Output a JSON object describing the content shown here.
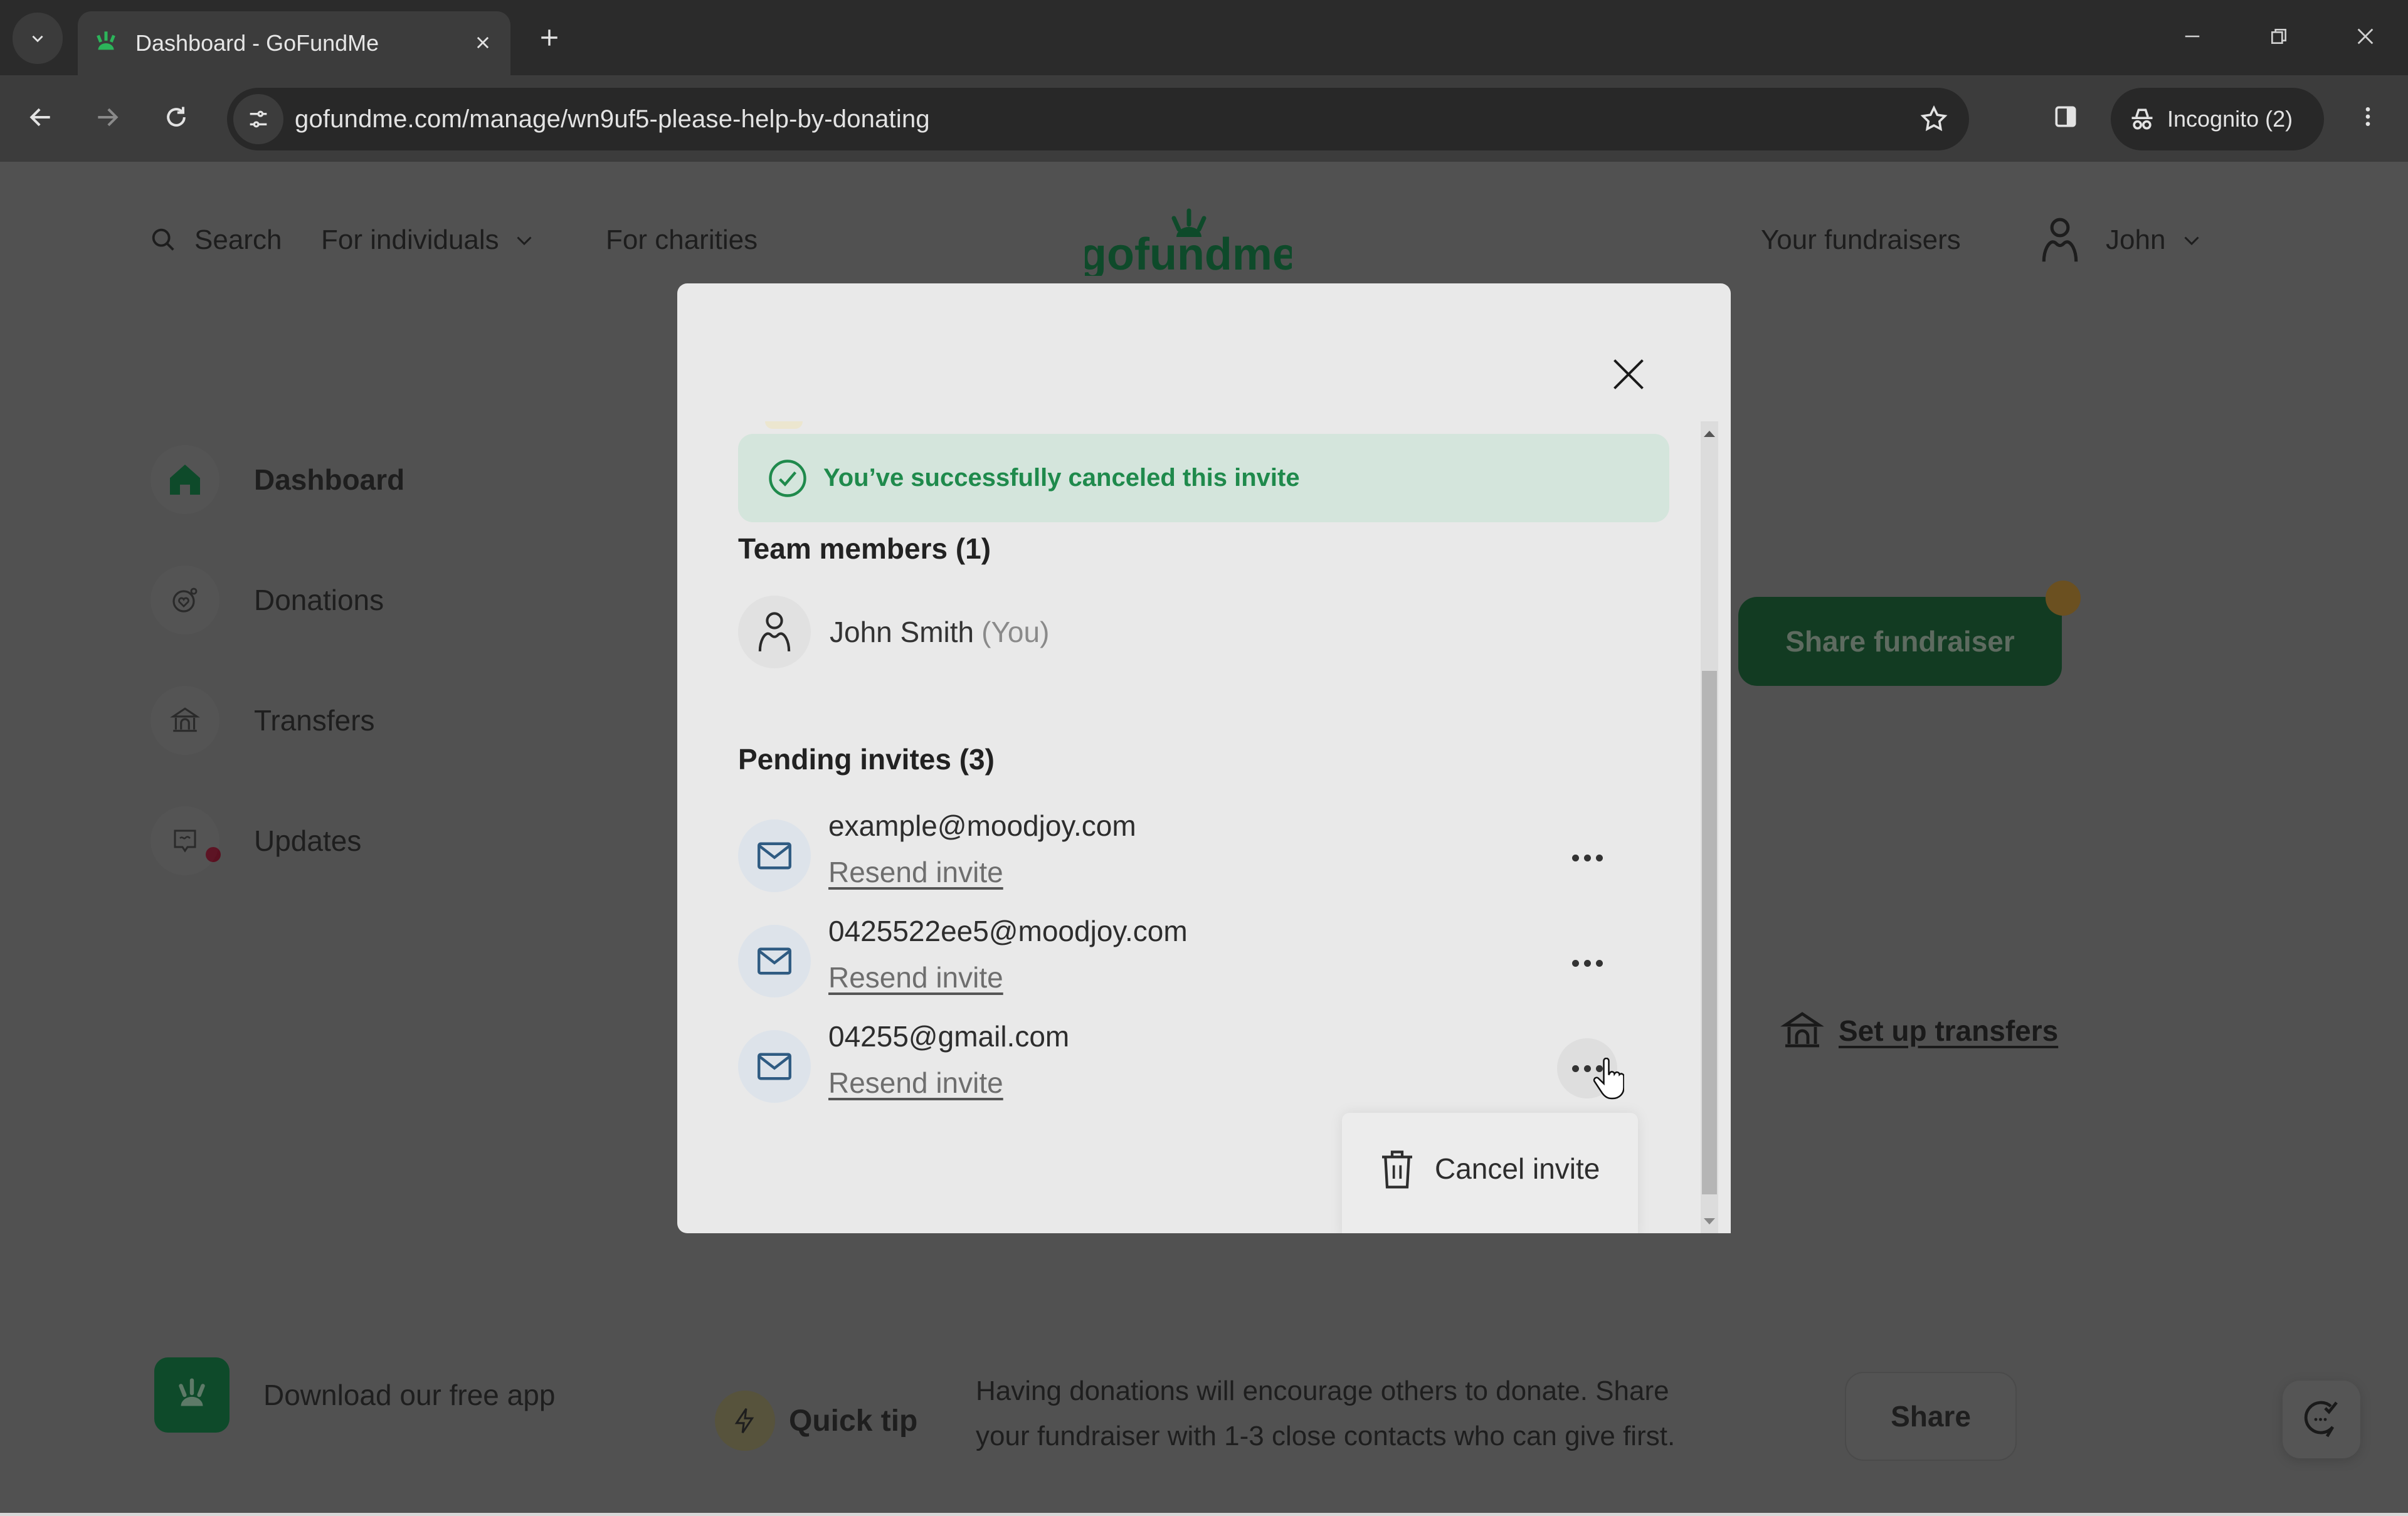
{
  "browser": {
    "tab_title": "Dashboard - GoFundMe",
    "url": "gofundme.com/manage/wn9uf5-please-help-by-donating",
    "profile_label": "Incognito (2)",
    "icons": {
      "tab_search": "chevron-down-icon",
      "favicon": "gofundme-logo-icon",
      "tab_close": "close-icon",
      "new_tab": "plus-icon",
      "back": "arrow-left-icon",
      "forward": "arrow-right-icon",
      "reload": "reload-icon",
      "site_info": "tune-icon",
      "bookmark": "star-icon",
      "side_panel": "side-panel-icon",
      "incognito": "incognito-icon",
      "menu": "kebab-vertical-icon",
      "minimize": "minimize-icon",
      "restore": "restore-icon",
      "close_window": "close-icon"
    }
  },
  "site_header": {
    "search_label": "Search",
    "for_individuals_label": "For individuals",
    "for_charities_label": "For charities",
    "logo_text": "gofundme",
    "your_fundraisers_label": "Your fundraisers",
    "user_name": "John"
  },
  "sidebar": {
    "items": [
      {
        "label": "Dashboard",
        "icon": "home-icon",
        "active": true
      },
      {
        "label": "Donations",
        "icon": "donations-icon",
        "active": false
      },
      {
        "label": "Transfers",
        "icon": "bank-icon",
        "active": false,
        "has_notification": true
      },
      {
        "label": "Updates",
        "icon": "updates-icon",
        "active": false
      }
    ],
    "download_app_label": "Download our free app"
  },
  "main": {
    "share_fundraiser_label": "Share fundraiser",
    "setup_transfers_label": "Set up transfers",
    "quick_tip_label": "Quick tip",
    "quick_tip_text_line1": "Having donations will encourage others to donate. Share",
    "quick_tip_text_line2": "your fundraiser with 1-3 close contacts who can give first.",
    "share_label": "Share"
  },
  "modal": {
    "success_message": "You’ve successfully canceled this invite",
    "team_members_heading": "Team members (1)",
    "team_members": [
      {
        "name": "John Smith",
        "suffix": "(You)"
      }
    ],
    "pending_invites_heading": "Pending invites (3)",
    "pending_invites": [
      {
        "email": "example@moodjoy.com",
        "resend_label": "Resend invite"
      },
      {
        "email": "0425522ee5@moodjoy.com",
        "resend_label": "Resend invite"
      },
      {
        "email": "04255@gmail.com",
        "resend_label": "Resend invite"
      }
    ],
    "menu": {
      "cancel_invite_label": "Cancel invite"
    }
  },
  "colors": {
    "brand_green": "#0e4a2a",
    "success_text": "#1f8a4c",
    "success_bg": "#d4e5dc",
    "notification_dot": "#5a1020"
  }
}
